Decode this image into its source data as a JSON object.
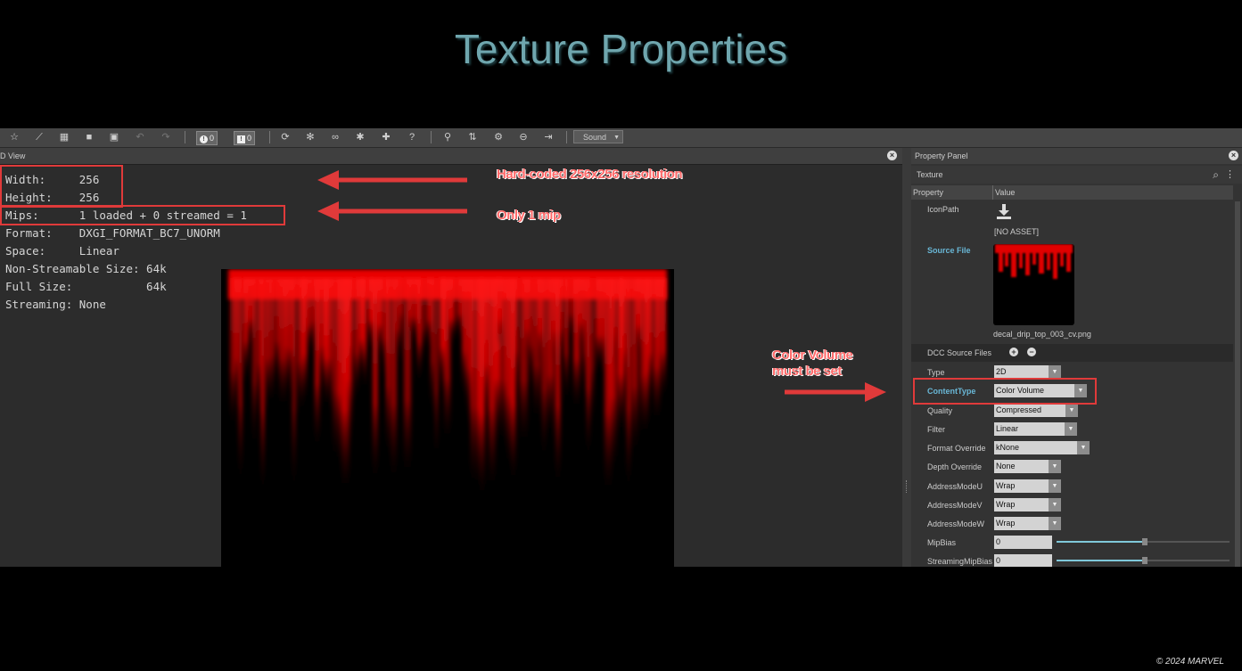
{
  "slide": {
    "title": "Texture Properties",
    "copyright": "© 2024 MARVEL"
  },
  "toolbar": {
    "error_count": "0",
    "warning_count": "0",
    "sound_label": "Sound"
  },
  "view_panel": {
    "title": "D View",
    "info_lines": [
      "Width:     256",
      "Height:    256",
      "Mips:      1 loaded + 0 streamed = 1",
      "Format:    DXGI_FORMAT_BC7_UNORM",
      "Space:     Linear",
      "Non-Streamable Size: 64k",
      "Full Size:           64k",
      "Streaming: None"
    ]
  },
  "annotations": {
    "resolution_note": "Hard-coded 256x256 resolution",
    "mip_note": "Only 1 mip",
    "color_volume_note_line1": "Color Volume",
    "color_volume_note_line2": "must be set"
  },
  "property_panel": {
    "title": "Property Panel",
    "subheader": "Texture",
    "col_property": "Property",
    "col_value": "Value",
    "icon_path_label": "IconPath",
    "icon_path_value": "[NO ASSET]",
    "source_file_label": "Source File",
    "source_file_name": "decal_drip_top_003_cv.png",
    "dcc_label": "DCC Source Files",
    "rows": [
      {
        "label": "Type",
        "value": "2D"
      },
      {
        "label": "ContentType",
        "value": "Color Volume"
      },
      {
        "label": "Quality",
        "value": "Compressed"
      },
      {
        "label": "Filter",
        "value": "Linear"
      },
      {
        "label": "Format Override",
        "value": "kNone"
      },
      {
        "label": "Depth Override",
        "value": "None"
      },
      {
        "label": "AddressModeU",
        "value": "Wrap"
      },
      {
        "label": "AddressModeV",
        "value": "Wrap"
      },
      {
        "label": "AddressModeW",
        "value": "Wrap"
      },
      {
        "label": "MipBias",
        "value": "0"
      },
      {
        "label": "StreamingMipBias",
        "value": "0"
      }
    ]
  },
  "colors": {
    "accent": "#69b7d6",
    "annotation": "#e03a3a",
    "title": "#6fa6ae"
  }
}
